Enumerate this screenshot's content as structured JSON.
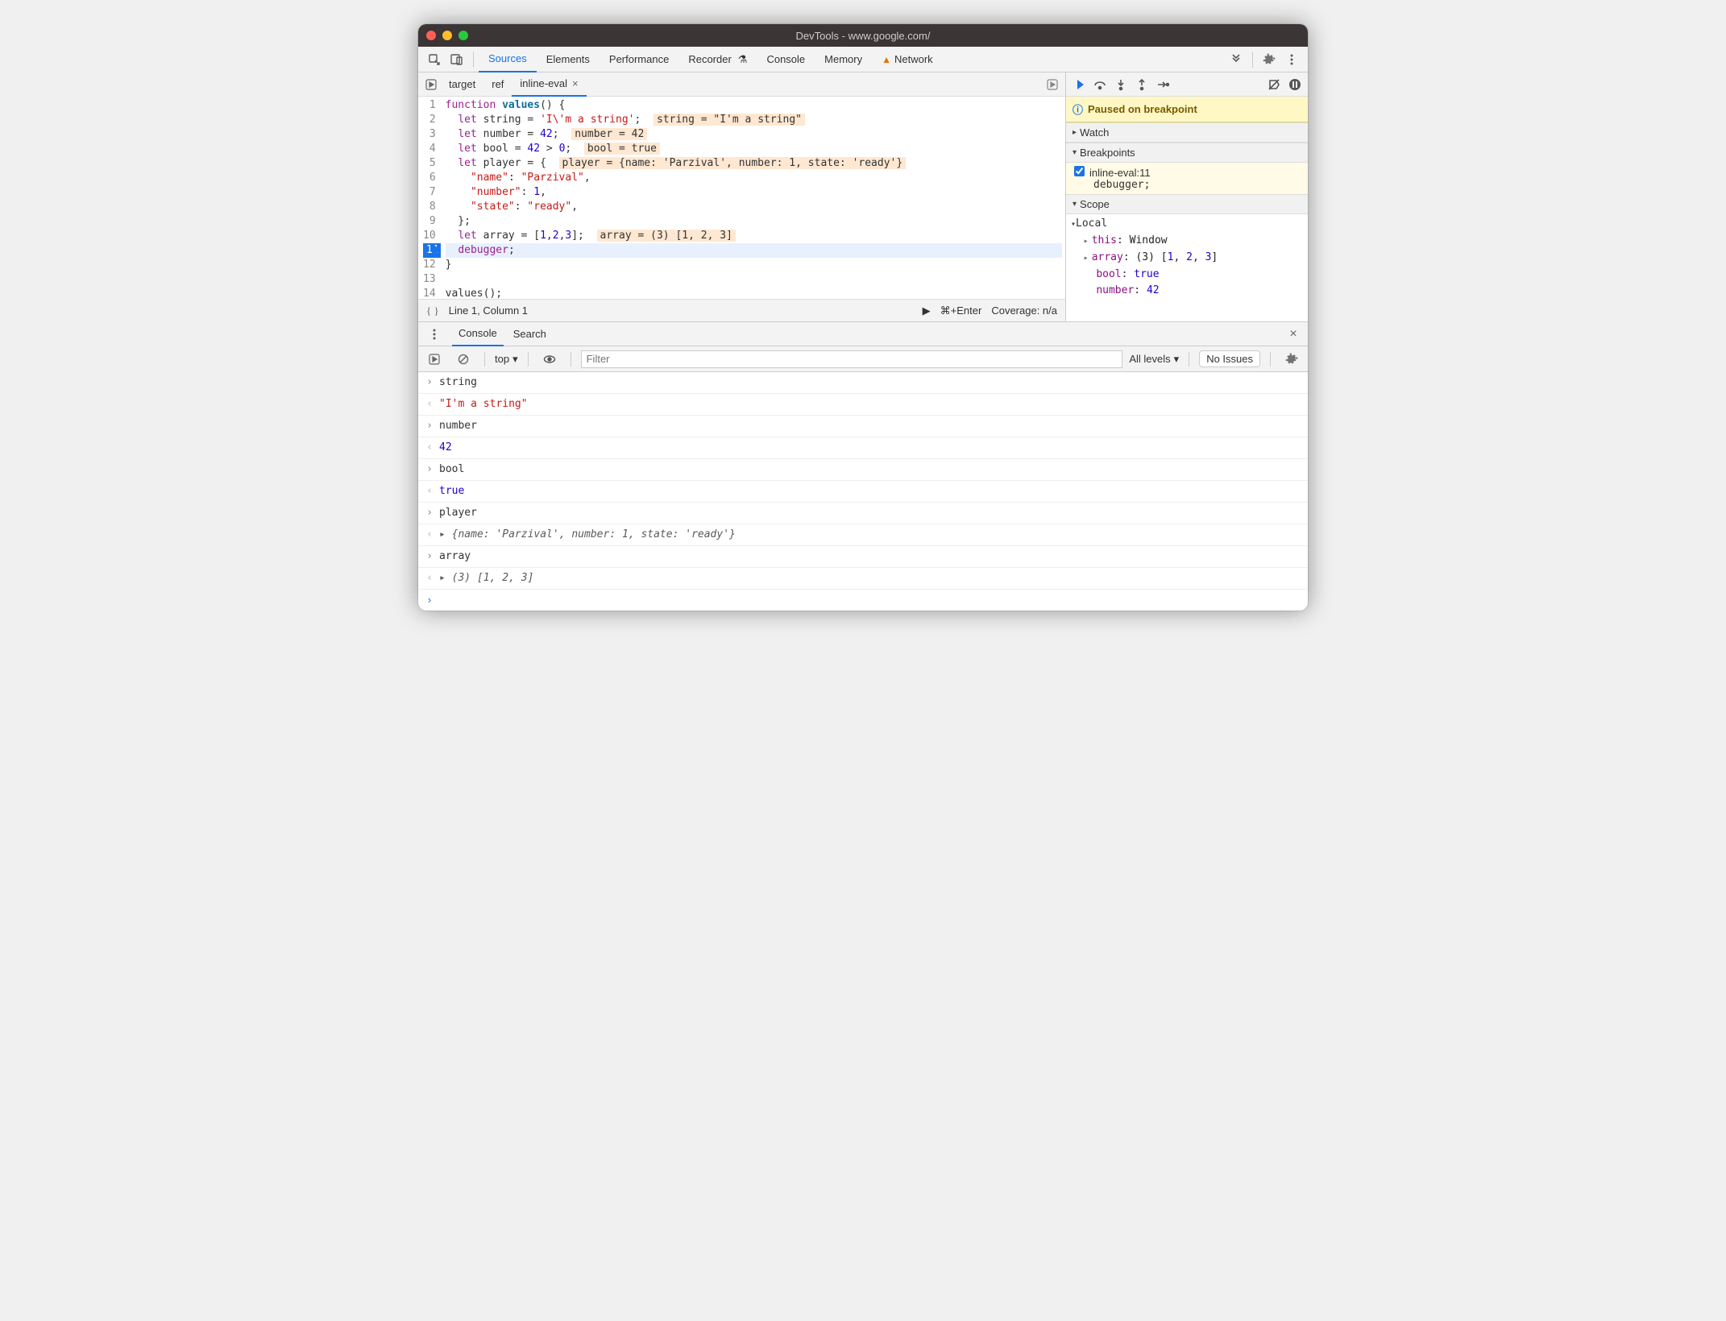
{
  "window": {
    "title": "DevTools - www.google.com/"
  },
  "main_tabs": {
    "items": [
      "Sources",
      "Elements",
      "Performance",
      "Recorder",
      "Console",
      "Memory",
      "Network"
    ],
    "active": 0,
    "warning_index": 6
  },
  "file_tabs": {
    "items": [
      "target",
      "ref",
      "inline-eval"
    ],
    "active": 2
  },
  "code": {
    "lines": [
      {
        "n": 1,
        "html": "<span class='kw'>function</span> <b style='color:#0f6e99'>values</b>() {"
      },
      {
        "n": 2,
        "html": "  <span class='kw'>let</span> string = <span class='str'>'I\\'m a string'</span>;  <span class='inline-hint'>string = \"I'm a string\"</span>"
      },
      {
        "n": 3,
        "html": "  <span class='kw'>let</span> number = <span class='num'>42</span>;  <span class='inline-hint'>number = 42</span>"
      },
      {
        "n": 4,
        "html": "  <span class='kw'>let</span> bool = <span class='num'>42</span> > <span class='num'>0</span>;  <span class='inline-hint'>bool = true</span>"
      },
      {
        "n": 5,
        "html": "  <span class='kw'>let</span> player = {  <span class='inline-hint'>player = {name: 'Parzival', number: 1, state: 'ready'}</span>"
      },
      {
        "n": 6,
        "html": "    <span class='prop'>\"name\"</span>: <span class='str'>\"Parzival\"</span>,"
      },
      {
        "n": 7,
        "html": "    <span class='prop'>\"number\"</span>: <span class='num'>1</span>,"
      },
      {
        "n": 8,
        "html": "    <span class='prop'>\"state\"</span>: <span class='str'>\"ready\"</span>,"
      },
      {
        "n": 9,
        "html": "  };"
      },
      {
        "n": 10,
        "html": "  <span class='kw'>let</span> array = [<span class='num'>1</span>,<span class='num'>2</span>,<span class='num'>3</span>];  <span class='inline-hint'>array = (3) [1, 2, 3]</span>"
      },
      {
        "n": 11,
        "html": "  <span class='dbg'>debugger</span>;",
        "active": true
      },
      {
        "n": 12,
        "html": "}"
      },
      {
        "n": 13,
        "html": ""
      },
      {
        "n": 14,
        "html": "values();"
      }
    ]
  },
  "status": {
    "cursor": "Line 1, Column 1",
    "run_hint": "⌘+Enter",
    "coverage": "Coverage: n/a"
  },
  "debug": {
    "paused": "Paused on breakpoint",
    "watch_head": "Watch",
    "breakpoints_head": "Breakpoints",
    "bp": {
      "file": "inline-eval:11",
      "snippet": "debugger;"
    },
    "scope_head": "Scope",
    "local_head": "Local",
    "local": {
      "this": "Window",
      "array": "(3) ",
      "array_items": [
        "1",
        "2",
        "3"
      ],
      "bool": "true",
      "number": "42"
    }
  },
  "drawer": {
    "tabs": [
      "Console",
      "Search"
    ],
    "active": 0,
    "context": "top",
    "filter_placeholder": "Filter",
    "levels": "All levels",
    "issues": "No Issues"
  },
  "console": {
    "rows": [
      {
        "t": "in",
        "body": "string"
      },
      {
        "t": "out",
        "kind": "str",
        "body": "\"I'm a string\""
      },
      {
        "t": "in",
        "body": "number"
      },
      {
        "t": "out",
        "kind": "num",
        "body": "42"
      },
      {
        "t": "in",
        "body": "bool"
      },
      {
        "t": "out",
        "kind": "bool",
        "body": "true"
      },
      {
        "t": "in",
        "body": "player"
      },
      {
        "t": "out",
        "kind": "obj",
        "body": "▸ {name: 'Parzival', number: 1, state: 'ready'}"
      },
      {
        "t": "in",
        "body": "array"
      },
      {
        "t": "out",
        "kind": "obj",
        "body": "▸ (3) [1, 2, 3]"
      }
    ]
  }
}
